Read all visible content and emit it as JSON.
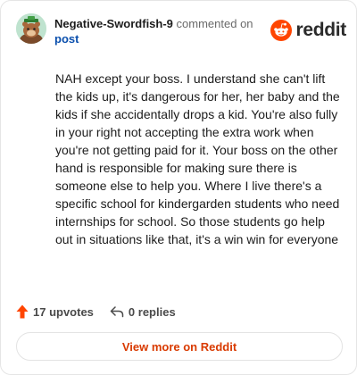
{
  "header": {
    "username": "Negative-Swordfish-9",
    "commented_text": "commented on",
    "post_link": "post",
    "brand": "reddit"
  },
  "comment": {
    "body": "NAH except your boss. I understand she can't lift the kids up, it's dangerous for her, her baby and the kids if she accidentally drops a kid. You're also fully in your right not accepting the extra work when you're not getting paid for it. Your boss on the other hand is responsible for making sure there is someone else to help you. Where I live there's a specific school for kindergarden students who need internships for school. So those students go help out in situations like that, it's a win win for everyone"
  },
  "footer": {
    "upvotes": "17 upvotes",
    "replies": "0 replies"
  },
  "actions": {
    "view_more": "View more on Reddit"
  },
  "colors": {
    "brand_orange": "#ff4500",
    "link_blue": "#0a4fad",
    "view_more_text": "#d93a00"
  },
  "icons": [
    "avatar-snoo",
    "reddit-logo-icon",
    "upvote-arrow-icon",
    "reply-arrow-icon"
  ]
}
